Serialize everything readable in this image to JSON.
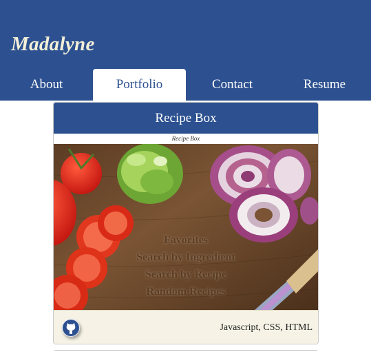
{
  "brand": "Madalyne",
  "nav": {
    "about": "About",
    "portfolio": "Portfolio",
    "contact": "Contact",
    "resume": "Resume"
  },
  "project": {
    "title": "Recipe Box",
    "image_caption": "Recipe Box",
    "menu": [
      "Favorites",
      "Search by Ingredient",
      "Search by Recipe",
      "Random Recipes"
    ],
    "tech": "Javascript, CSS, HTML",
    "link_icon": "github-icon"
  },
  "colors": {
    "header": "#2d5190",
    "brand_text": "#f3efd8",
    "footer_bg": "#f6f3e6"
  }
}
